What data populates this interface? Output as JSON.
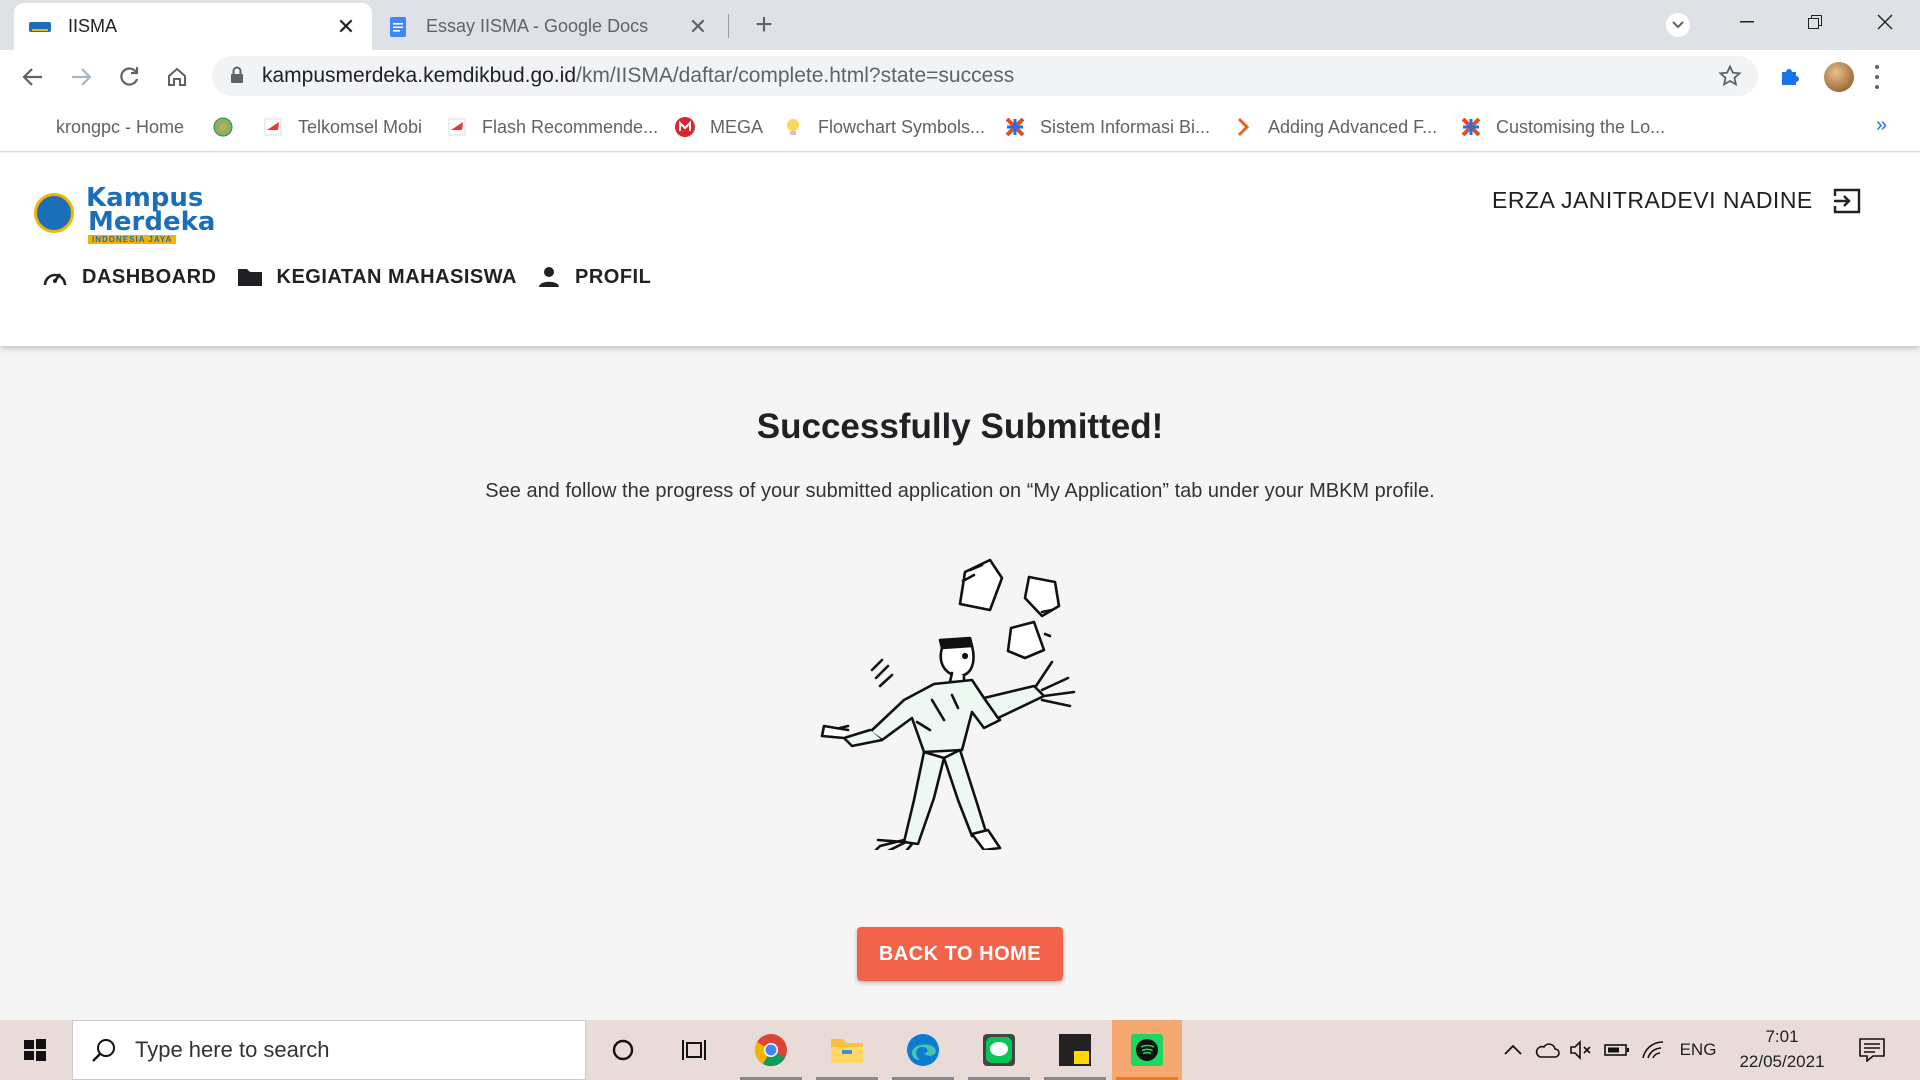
{
  "browser": {
    "tabs": [
      {
        "title": "IISMA",
        "active": true
      },
      {
        "title": "Essay IISMA - Google Docs",
        "active": false
      }
    ],
    "url_host": "kampusmerdeka.kemdikbud.go.id",
    "url_path": "/km/IISMA/daftar/complete.html?state=success",
    "bookmarks": [
      {
        "label": "krongpc - Home"
      },
      {
        "label": ""
      },
      {
        "label": "Telkomsel Mobi"
      },
      {
        "label": "Flash Recommende..."
      },
      {
        "label": "MEGA"
      },
      {
        "label": "Flowchart Symbols..."
      },
      {
        "label": "Sistem Informasi Bi..."
      },
      {
        "label": "Adding Advanced F..."
      },
      {
        "label": "Customising the Lo..."
      }
    ],
    "bookmarks_more": "»"
  },
  "header": {
    "logo": {
      "line1": "Kampus",
      "line2": "Merdeka",
      "tagline": "INDONESIA JAYA"
    },
    "user_name": "ERZA JANITRADEVI NADINE",
    "nav": [
      {
        "label": "DASHBOARD",
        "icon": "speedometer-icon"
      },
      {
        "label": "KEGIATAN MAHASISWA",
        "icon": "folder-icon"
      },
      {
        "label": "PROFIL",
        "icon": "person-icon"
      }
    ]
  },
  "main": {
    "title": "Successfully Submitted!",
    "message": "See and follow the progress of your submitted application on “My Application” tab under your MBKM profile.",
    "button_label": "BACK TO HOME"
  },
  "taskbar": {
    "search_placeholder": "Type here to search",
    "language": "ENG",
    "time": "7:01",
    "date": "22/05/2021"
  },
  "colors": {
    "accent": "#f2634c",
    "brand_blue": "#1b6fb8",
    "brand_yellow": "#f2b400"
  }
}
